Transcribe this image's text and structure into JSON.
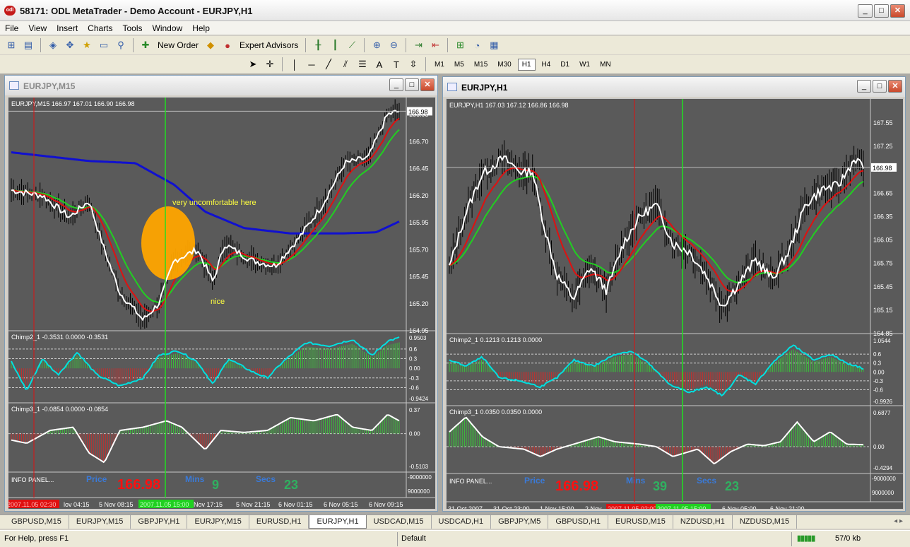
{
  "window": {
    "title": "58171: ODL MetaTrader - Demo Account - EURJPY,H1",
    "icon_text": "odl"
  },
  "menu": [
    "File",
    "View",
    "Insert",
    "Charts",
    "Tools",
    "Window",
    "Help"
  ],
  "toolbar": {
    "new_order": "New Order",
    "expert_advisors": "Expert Advisors",
    "timeframes": [
      "M1",
      "M5",
      "M15",
      "M30",
      "H1",
      "H4",
      "D1",
      "W1",
      "MN"
    ],
    "active_timeframe": "H1",
    "text_tool": "A"
  },
  "colors": {
    "chart_bg": "#5a5a5a",
    "price": "#ffffff",
    "ma_red": "#e01010",
    "ma_green": "#20d020",
    "ma_blue": "#1010d0",
    "osc_cyan": "#00e0e0",
    "hist_green": "#3ac03a",
    "hist_red": "#c03030",
    "marker": "#ffa500",
    "yellow_text": "#ffff40",
    "info_blue": "#3a7ad8",
    "info_red": "#ff1010",
    "info_green": "#30b060"
  },
  "left_chart": {
    "window_title": "EURJPY,M15",
    "header": "EURJPY,M15  166.97 167.01 166.90 166.98",
    "price_label": "166.98",
    "price_ticks": [
      "166.95",
      "166.70",
      "166.45",
      "166.20",
      "165.95",
      "165.70",
      "165.45",
      "165.20",
      "164.95"
    ],
    "annotation_top": "very uncomfortable here",
    "annotation_bottom": "nice",
    "chimp2": {
      "header": "Chimp2_1 -0.3531 0.0000 -0.3531",
      "ticks": [
        "0.9503",
        "0.6",
        "0.3",
        "0.00",
        "-0.3",
        "-0.6",
        "-0.9424"
      ]
    },
    "chimp3": {
      "header": "Chimp3_1 -0.0854 0.0000 -0.0854",
      "ticks": [
        "0.37",
        "0.00",
        "-0.5103"
      ]
    },
    "info": {
      "label": "INFO PANEL...",
      "price_label": "Price",
      "price_value": "166.98",
      "mins_label": "Mins",
      "mins_value": "9",
      "secs_label": "Secs",
      "secs_value": "23",
      "ticks": [
        "-9000000",
        "9000000"
      ]
    },
    "time_red": "2007.11.05 02:30",
    "time_green": "2007.11.05 15:00",
    "time_ticks": [
      "lov 04:15",
      "5 Nov 08:15",
      "Nov 17:15",
      "5 Nov 21:15",
      "6 Nov 01:15",
      "6 Nov 05:15",
      "6 Nov 09:15"
    ]
  },
  "right_chart": {
    "window_title": "EURJPY,H1",
    "header": "EURJPY,H1  167.03 167.12 166.86 166.98",
    "price_label": "166.98",
    "price_ticks": [
      "167.55",
      "167.25",
      "166.95",
      "166.65",
      "166.35",
      "166.05",
      "165.75",
      "165.45",
      "165.15",
      "164.85"
    ],
    "chimp2": {
      "header": "Chimp2_1 0.1213 0.1213 0.0000",
      "ticks": [
        "1.0544",
        "0.6",
        "0.3",
        "0.00",
        "-0.3",
        "-0.6",
        "-0.9926"
      ]
    },
    "chimp3": {
      "header": "Chimp3_1 0.0350 0.0350 0.0000",
      "ticks": [
        "0.6877",
        "0.00",
        "-0.4294"
      ]
    },
    "info": {
      "label": "INFO PANEL...",
      "price_label": "Price",
      "price_value": "166.98",
      "mins_label": "Mins",
      "mins_value": "39",
      "secs_label": "Secs",
      "secs_value": "23",
      "ticks": [
        "-9000000",
        "9000000"
      ]
    },
    "time_red": "2007.11.05 02:00",
    "time_green": "2007.11.05 15:00",
    "time_ticks": [
      "31 Oct 2007",
      "31 Oct 23:00",
      "1 Nov 15:00",
      "2 Nov",
      "6 Nov 05:00",
      "6 Nov 21:00"
    ]
  },
  "tabs": [
    "GBPUSD,M15",
    "EURJPY,M15",
    "GBPJPY,H1",
    "EURJPY,M15",
    "EURUSD,H1",
    "EURJPY,H1",
    "USDCAD,M15",
    "USDCAD,H1",
    "GBPJPY,M5",
    "GBPUSD,H1",
    "EURUSD,M15",
    "NZDUSD,H1",
    "NZDUSD,M15"
  ],
  "active_tab": 5,
  "status": {
    "help": "For Help, press F1",
    "profile": "Default",
    "traffic": "57/0 kb"
  }
}
